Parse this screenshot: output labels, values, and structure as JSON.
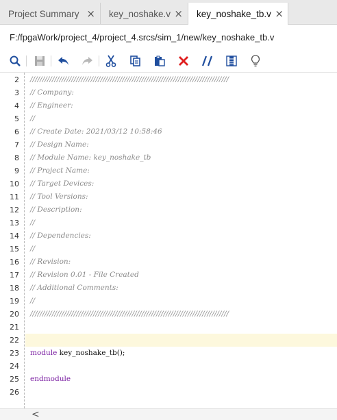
{
  "tabs": [
    {
      "label": "Project Summary",
      "active": false
    },
    {
      "label": "key_noshake.v",
      "active": false
    },
    {
      "label": "key_noshake_tb.v",
      "active": true
    }
  ],
  "tab_close_glyph": "×",
  "path": "F:/fpgaWork/project_4/project_4.srcs/sim_1/new/key_noshake_tb.v",
  "toolbar": [
    {
      "name": "search-icon",
      "enabled": true
    },
    {
      "name": "save-icon",
      "enabled": false
    },
    {
      "name": "undo-icon",
      "enabled": true
    },
    {
      "name": "redo-icon",
      "enabled": false
    },
    {
      "name": "cut-icon",
      "enabled": true
    },
    {
      "name": "copy-icon",
      "enabled": true
    },
    {
      "name": "paste-icon",
      "enabled": true
    },
    {
      "name": "delete-icon",
      "enabled": true
    },
    {
      "name": "comment-toggle-icon",
      "enabled": true
    },
    {
      "name": "column-select-icon",
      "enabled": true
    },
    {
      "name": "lightbulb-icon",
      "enabled": true
    }
  ],
  "colors": {
    "comment": "#8a8a8a",
    "keyword": "#7b1fa2",
    "current_line": "#fdf8dd",
    "delete_red": "#e02020",
    "toolbar_blue": "#1f4e9e"
  },
  "editor": {
    "current_line": "22",
    "lines": [
      {
        "num": "2",
        "text": "//////////////////////////////////////////////////////////////////////////////////",
        "kind": "cmt"
      },
      {
        "num": "3",
        "text": "// Company:",
        "kind": "cmt"
      },
      {
        "num": "4",
        "text": "// Engineer:",
        "kind": "cmt"
      },
      {
        "num": "5",
        "text": "//",
        "kind": "cmt"
      },
      {
        "num": "6",
        "text": "// Create Date: 2021/03/12 10:58:46",
        "kind": "cmt"
      },
      {
        "num": "7",
        "text": "// Design Name:",
        "kind": "cmt"
      },
      {
        "num": "8",
        "text": "// Module Name: key_noshake_tb",
        "kind": "cmt"
      },
      {
        "num": "9",
        "text": "// Project Name:",
        "kind": "cmt"
      },
      {
        "num": "10",
        "text": "// Target Devices:",
        "kind": "cmt"
      },
      {
        "num": "11",
        "text": "// Tool Versions:",
        "kind": "cmt"
      },
      {
        "num": "12",
        "text": "// Description:",
        "kind": "cmt"
      },
      {
        "num": "13",
        "text": "//",
        "kind": "cmt"
      },
      {
        "num": "14",
        "text": "// Dependencies:",
        "kind": "cmt"
      },
      {
        "num": "15",
        "text": "//",
        "kind": "cmt"
      },
      {
        "num": "16",
        "text": "// Revision:",
        "kind": "cmt"
      },
      {
        "num": "17",
        "text": "// Revision 0.01 - File Created",
        "kind": "cmt"
      },
      {
        "num": "18",
        "text": "// Additional Comments:",
        "kind": "cmt"
      },
      {
        "num": "19",
        "text": "//",
        "kind": "cmt"
      },
      {
        "num": "20",
        "text": "//////////////////////////////////////////////////////////////////////////////////",
        "kind": "cmt"
      },
      {
        "num": "21",
        "text": "",
        "kind": "plain"
      },
      {
        "num": "22",
        "text": "",
        "kind": "plain"
      },
      {
        "num": "23",
        "kw": "module",
        "text": " key_noshake_tb();",
        "kind": "module"
      },
      {
        "num": "24",
        "text": "",
        "kind": "plain"
      },
      {
        "num": "25",
        "text": "endmodule",
        "kind": "kw"
      },
      {
        "num": "26",
        "text": "",
        "kind": "plain"
      }
    ]
  },
  "hscroll": {
    "left_arrow": "<"
  }
}
